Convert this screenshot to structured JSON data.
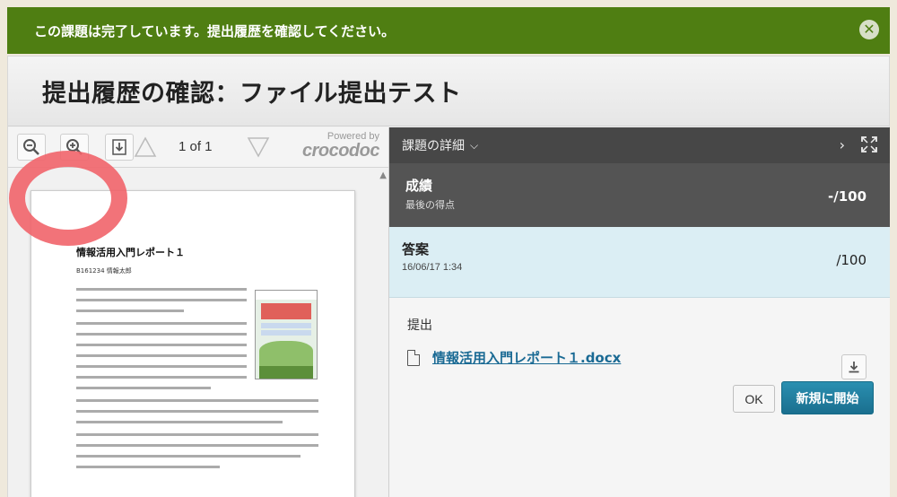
{
  "banner": {
    "message": "この課題は完了しています。提出履歴を確認してください。",
    "close_icon": "close-icon"
  },
  "page": {
    "title": "提出履歴の確認：ファイル提出テスト"
  },
  "viewer": {
    "page_count": "1 of 1",
    "powered_by": "Powered by",
    "brand": "crocodoc",
    "document": {
      "title": "情報活用入門レポート１",
      "author": "B161234 情報太郎"
    }
  },
  "details": {
    "header": "課題の詳細",
    "grade": {
      "label": "成績",
      "sub": "最後の得点",
      "score": "-/100"
    },
    "attempt": {
      "label": "答案",
      "date": "16/06/17 1:34",
      "score": "/100"
    },
    "submission": {
      "label": "提出",
      "file": "情報活用入門レポート１.docx"
    },
    "buttons": {
      "ok": "OK",
      "new": "新規に開始"
    }
  },
  "colors": {
    "banner": "#4f7e12",
    "header_dark": "#474747",
    "grade_bg": "#545454",
    "attempt_bg": "#dbeef4",
    "primary_button": "#1a6f8f",
    "link": "#1a6a94",
    "annotation_ring": "#f1646a"
  }
}
